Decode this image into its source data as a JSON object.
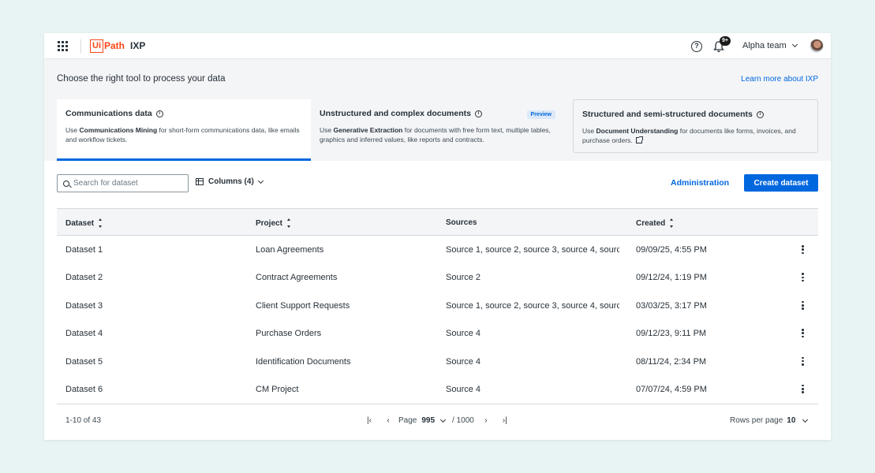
{
  "header": {
    "logo_ui": "Ui",
    "logo_path": "Path",
    "product": "IXP",
    "notification_badge": "9+",
    "team_name": "Alpha team",
    "help_glyph": "?"
  },
  "chooser": {
    "title": "Choose the right tool to process your data",
    "learn_more": "Learn more about IXP",
    "cards": [
      {
        "title": "Communications data",
        "desc_pre": "Use ",
        "desc_bold": "Communications Mining",
        "desc_post": " for short-form communications data, like emails and workflow tickets."
      },
      {
        "title": "Unstructured and complex documents",
        "badge": "Preview",
        "desc_pre": "Use ",
        "desc_bold": "Generative Extraction",
        "desc_post": " for documents with free form text, multiple tables, graphics and inferred values, like reports and contracts."
      },
      {
        "title": "Structured and semi-structured documents",
        "desc_pre": "Use ",
        "desc_bold": "Document Understanding",
        "desc_post": " for documents like forms, invoices, and purchase orders."
      }
    ]
  },
  "toolbar": {
    "search_placeholder": "Search for dataset",
    "columns_label": "Columns (4)",
    "administration": "Administration",
    "create": "Create dataset"
  },
  "table": {
    "headers": [
      "Dataset",
      "Project",
      "Sources",
      "Created"
    ],
    "rows": [
      [
        "Dataset 1",
        "Loan Agreements",
        "Source 1, source 2, source 3, source 4, source…",
        "09/09/25, 4:55 PM"
      ],
      [
        "Dataset 2",
        "Contract Agreements",
        "Source 2",
        "09/12/24, 1:19 PM"
      ],
      [
        "Dataset 3",
        "Client Support Requests",
        "Source 1, source 2, source 3, source 4, source…",
        "03/03/25, 3:17 PM"
      ],
      [
        "Dataset 4",
        "Purchase Orders",
        "Source 4",
        "09/12/23, 9:11 PM"
      ],
      [
        "Dataset 5",
        "Identification Documents",
        "Source 4",
        "08/11/24, 2:34 PM"
      ],
      [
        "Dataset 6",
        "CM Project",
        "Source 4",
        "07/07/24, 4:59 PM"
      ]
    ]
  },
  "footer": {
    "range": "1-10 of 43",
    "page_label": "Page",
    "page": "995",
    "total": "/ 1000",
    "rows_label": "Rows per page",
    "rows_value": "10"
  },
  "colors": {
    "accent": "#0067df",
    "brand": "#fa4616",
    "background": "#e8f3f4"
  }
}
